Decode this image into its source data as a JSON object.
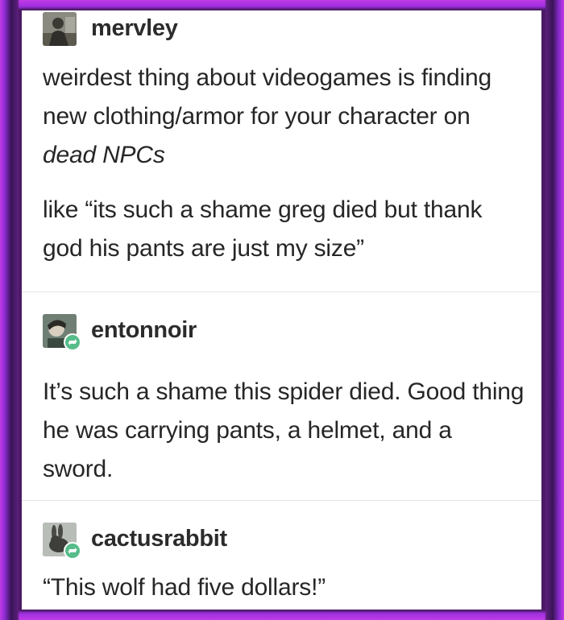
{
  "posts": [
    {
      "username": "mervley",
      "avatar_icon": "user-photo-avatar",
      "reblog": false,
      "paragraphs": [
        {
          "text_before": "weirdest thing about videogames is finding new clothing/armor for your character on ",
          "text_emphasis": "dead NPCs",
          "text_after": ""
        },
        {
          "text_before": "like “its such a shame greg died but thank god his pants are just my size”",
          "text_emphasis": "",
          "text_after": ""
        }
      ]
    },
    {
      "username": "entonnoir",
      "avatar_icon": "user-photo-avatar",
      "reblog": true,
      "reblog_icon": "reblog-icon",
      "paragraphs": [
        {
          "text_before": "It’s such a shame this spider died. Good thing he was carrying pants, a helmet, and a sword.",
          "text_emphasis": "",
          "text_after": ""
        }
      ]
    },
    {
      "username": "cactusrabbit",
      "avatar_icon": "rabbit-photo-avatar",
      "reblog": true,
      "reblog_icon": "reblog-icon",
      "paragraphs": [
        {
          "text_before": "“This wolf had five dollars!”",
          "text_emphasis": "",
          "text_after": ""
        }
      ]
    }
  ],
  "colors": {
    "frame": "#c13ae6",
    "card": "#ffffff",
    "text": "#262626",
    "reblog_badge": "#56bc8a"
  }
}
